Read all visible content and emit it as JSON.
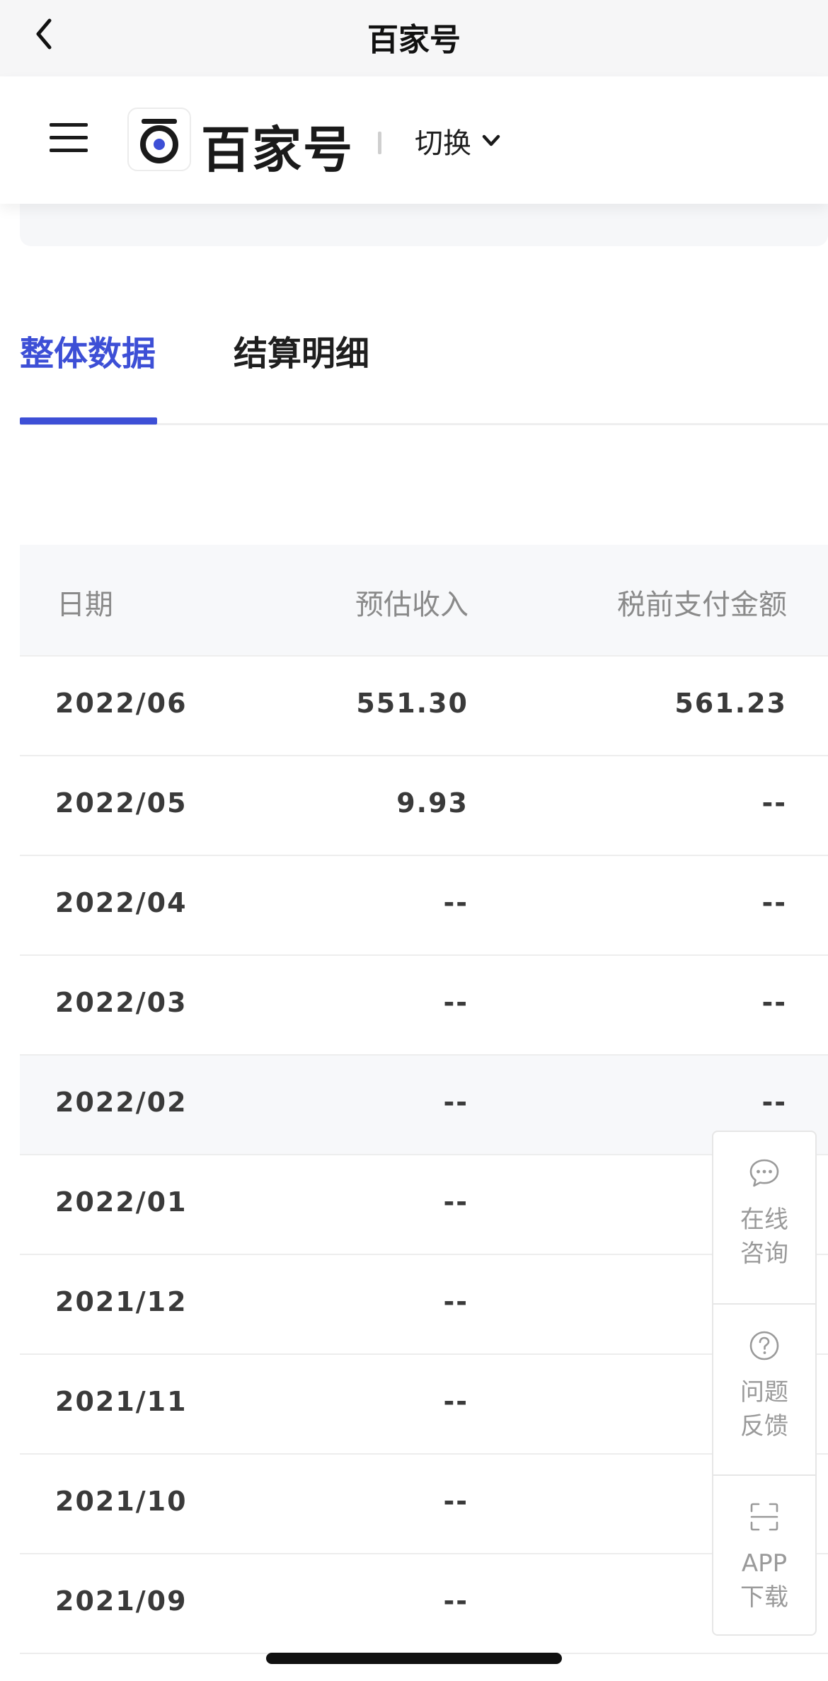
{
  "navbar": {
    "title": "百家号"
  },
  "header": {
    "brand": "百家号",
    "switch_label": "切换"
  },
  "tabs": [
    {
      "label": "整体数据",
      "active": true
    },
    {
      "label": "结算明细",
      "active": false
    }
  ],
  "table": {
    "columns": [
      "日期",
      "预估收入",
      "税前支付金额"
    ],
    "rows": [
      {
        "date": "2022/06",
        "estimated": "551.30",
        "pretax": "561.23"
      },
      {
        "date": "2022/05",
        "estimated": "9.93",
        "pretax": "--"
      },
      {
        "date": "2022/04",
        "estimated": "--",
        "pretax": "--"
      },
      {
        "date": "2022/03",
        "estimated": "--",
        "pretax": "--"
      },
      {
        "date": "2022/02",
        "estimated": "--",
        "pretax": "--"
      },
      {
        "date": "2022/01",
        "estimated": "--",
        "pretax": ""
      },
      {
        "date": "2021/12",
        "estimated": "--",
        "pretax": ""
      },
      {
        "date": "2021/11",
        "estimated": "--",
        "pretax": ""
      },
      {
        "date": "2021/10",
        "estimated": "--",
        "pretax": ""
      },
      {
        "date": "2021/09",
        "estimated": "--",
        "pretax": ""
      }
    ]
  },
  "float_panel": {
    "items": [
      {
        "line1": "在线",
        "line2": "咨询",
        "icon": "chat-bubble-icon"
      },
      {
        "line1": "问题",
        "line2": "反馈",
        "icon": "question-circle-icon"
      },
      {
        "line1": "APP",
        "line2": "下载",
        "icon": "scan-icon"
      }
    ]
  },
  "colors": {
    "accent": "#3d4fd6",
    "logo_dot": "#3d4fd6"
  }
}
